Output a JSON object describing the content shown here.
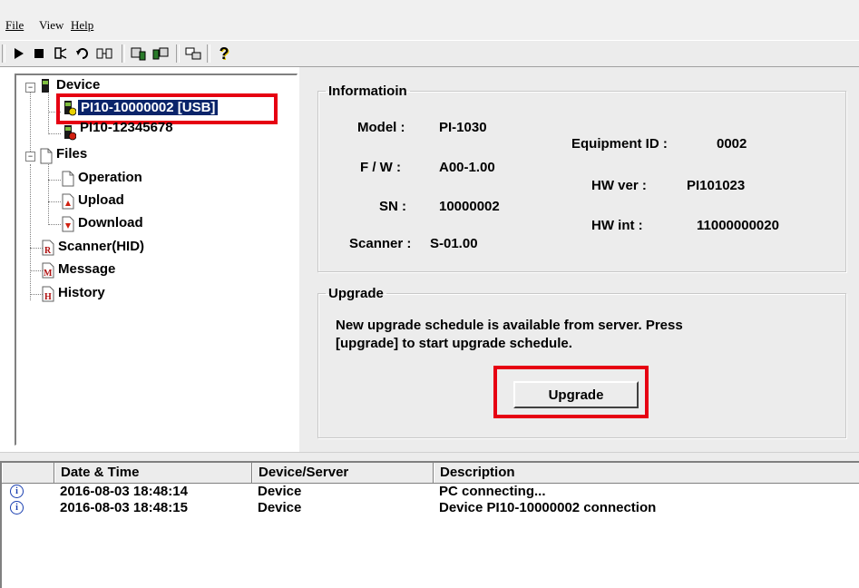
{
  "menu": [
    {
      "label": "File"
    },
    {
      "label": "View"
    },
    {
      "label": "Help"
    }
  ],
  "toolbar": {
    "buttons": [
      "play-icon",
      "stop-icon",
      "device-icon",
      "refresh-icon",
      "transfer-icon",
      "upload-device-icon",
      "network-icon",
      "settings-icon",
      "help-icon"
    ]
  },
  "tree": {
    "device": {
      "label": "Device"
    },
    "device_items": [
      {
        "label": "PI10-10000002 [USB]",
        "selected": true
      },
      {
        "label": "PI10-12345678",
        "selected": false
      }
    ],
    "files": {
      "label": "Files"
    },
    "files_items": [
      {
        "label": "Operation"
      },
      {
        "label": "Upload"
      },
      {
        "label": "Download"
      }
    ],
    "scanner": {
      "label": "Scanner(HID)"
    },
    "message": {
      "label": "Message"
    },
    "history": {
      "label": "History"
    }
  },
  "info": {
    "legend": "Informatioin",
    "model_label": "Model :",
    "model_value": "PI-1030",
    "fw_label": "F / W :",
    "fw_value": "A00-1.00",
    "sn_label": "SN :",
    "sn_value": "10000002",
    "scanner_label": "Scanner :",
    "scanner_value": "S-01.00",
    "equipment_label": "Equipment ID :",
    "equipment_value": "0002",
    "hwver_label": "HW ver :",
    "hwver_value": "PI101023",
    "hwint_label": "HW int :",
    "hwint_value": "11000000020"
  },
  "upgrade": {
    "legend": "Upgrade",
    "message_line1": "New upgrade schedule is available from server. Press",
    "message_line2": "[upgrade] to start upgrade schedule.",
    "button_label": "Upgrade"
  },
  "log": {
    "columns": [
      "",
      "Date & Time",
      "Device/Server",
      "Description"
    ],
    "rows": [
      {
        "datetime": "2016-08-03 18:48:14",
        "source": "Device",
        "description": "PC connecting..."
      },
      {
        "datetime": "2016-08-03 18:48:15",
        "source": "Device",
        "description": "Device PI10-10000002 connection"
      }
    ]
  },
  "colors": {
    "selection": "#0a246a",
    "highlight_box": "#e60012",
    "panel_bg": "#ececec"
  }
}
